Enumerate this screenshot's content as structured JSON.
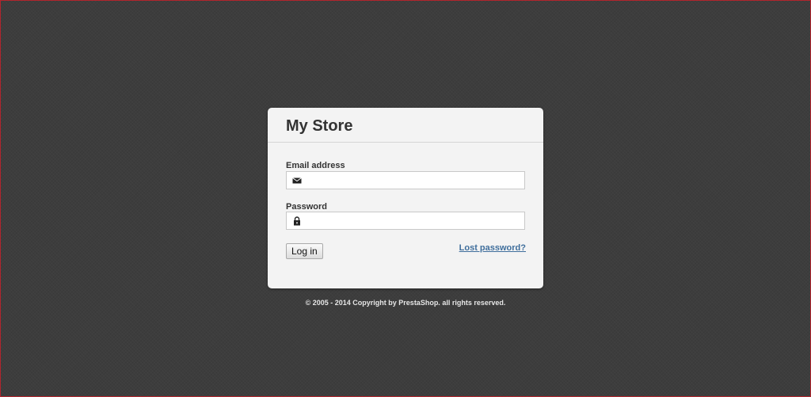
{
  "store": {
    "title": "My Store"
  },
  "form": {
    "email_label": "Email address",
    "email_value": "",
    "email_icon": "envelope-icon",
    "password_label": "Password",
    "password_value": "",
    "password_icon": "lock-icon",
    "login_label": "Log in",
    "lost_password_label": "Lost password?"
  },
  "footer": {
    "copyright": "© 2005 - 2014 Copyright by PrestaShop. all rights reserved."
  },
  "colors": {
    "background": "#3d3d3d",
    "panel": "#f3f3f3",
    "link": "#3f6e9c",
    "frame_border": "#b3252d"
  }
}
